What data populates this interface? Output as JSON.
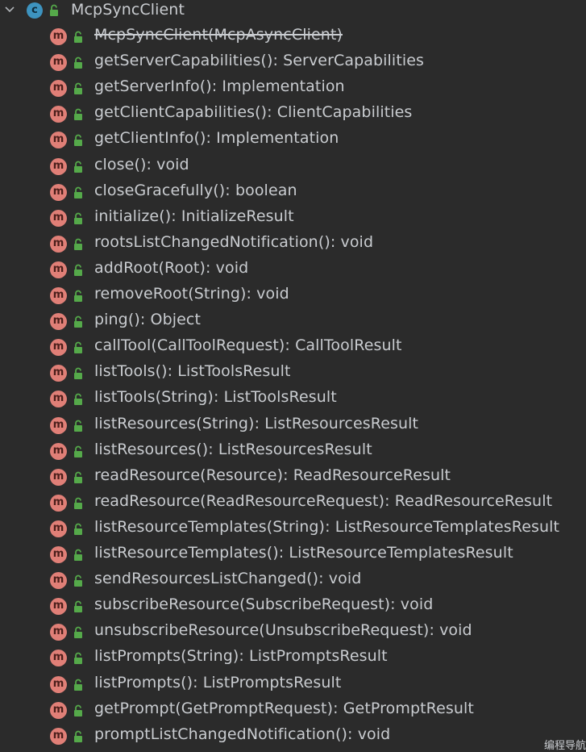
{
  "tree": {
    "class_name": "McpSyncClient",
    "class_icon_letter": "c",
    "method_icon_letter": "m",
    "expanded": true,
    "colors": {
      "background": "#2b2b2b",
      "text": "#c9ccd0",
      "class_icon": "#3d93bf",
      "method_icon": "#e07f77",
      "lock": "#55a94a"
    },
    "methods": [
      {
        "label": "McpSyncClient(McpAsyncClient)",
        "deprecated": true
      },
      {
        "label": "getServerCapabilities(): ServerCapabilities"
      },
      {
        "label": "getServerInfo(): Implementation"
      },
      {
        "label": "getClientCapabilities(): ClientCapabilities"
      },
      {
        "label": "getClientInfo(): Implementation"
      },
      {
        "label": "close(): void"
      },
      {
        "label": "closeGracefully(): boolean"
      },
      {
        "label": "initialize(): InitializeResult"
      },
      {
        "label": "rootsListChangedNotification(): void"
      },
      {
        "label": "addRoot(Root): void"
      },
      {
        "label": "removeRoot(String): void"
      },
      {
        "label": "ping(): Object"
      },
      {
        "label": "callTool(CallToolRequest): CallToolResult"
      },
      {
        "label": "listTools(): ListToolsResult"
      },
      {
        "label": "listTools(String): ListToolsResult"
      },
      {
        "label": "listResources(String): ListResourcesResult"
      },
      {
        "label": "listResources(): ListResourcesResult"
      },
      {
        "label": "readResource(Resource): ReadResourceResult"
      },
      {
        "label": "readResource(ReadResourceRequest): ReadResourceResult"
      },
      {
        "label": "listResourceTemplates(String): ListResourceTemplatesResult"
      },
      {
        "label": "listResourceTemplates(): ListResourceTemplatesResult"
      },
      {
        "label": "sendResourcesListChanged(): void"
      },
      {
        "label": "subscribeResource(SubscribeRequest): void"
      },
      {
        "label": "unsubscribeResource(UnsubscribeRequest): void"
      },
      {
        "label": "listPrompts(String): ListPromptsResult"
      },
      {
        "label": "listPrompts(): ListPromptsResult"
      },
      {
        "label": "getPrompt(GetPromptRequest): GetPromptResult"
      },
      {
        "label": "promptListChangedNotification(): void"
      }
    ]
  },
  "watermark": "编程导航"
}
